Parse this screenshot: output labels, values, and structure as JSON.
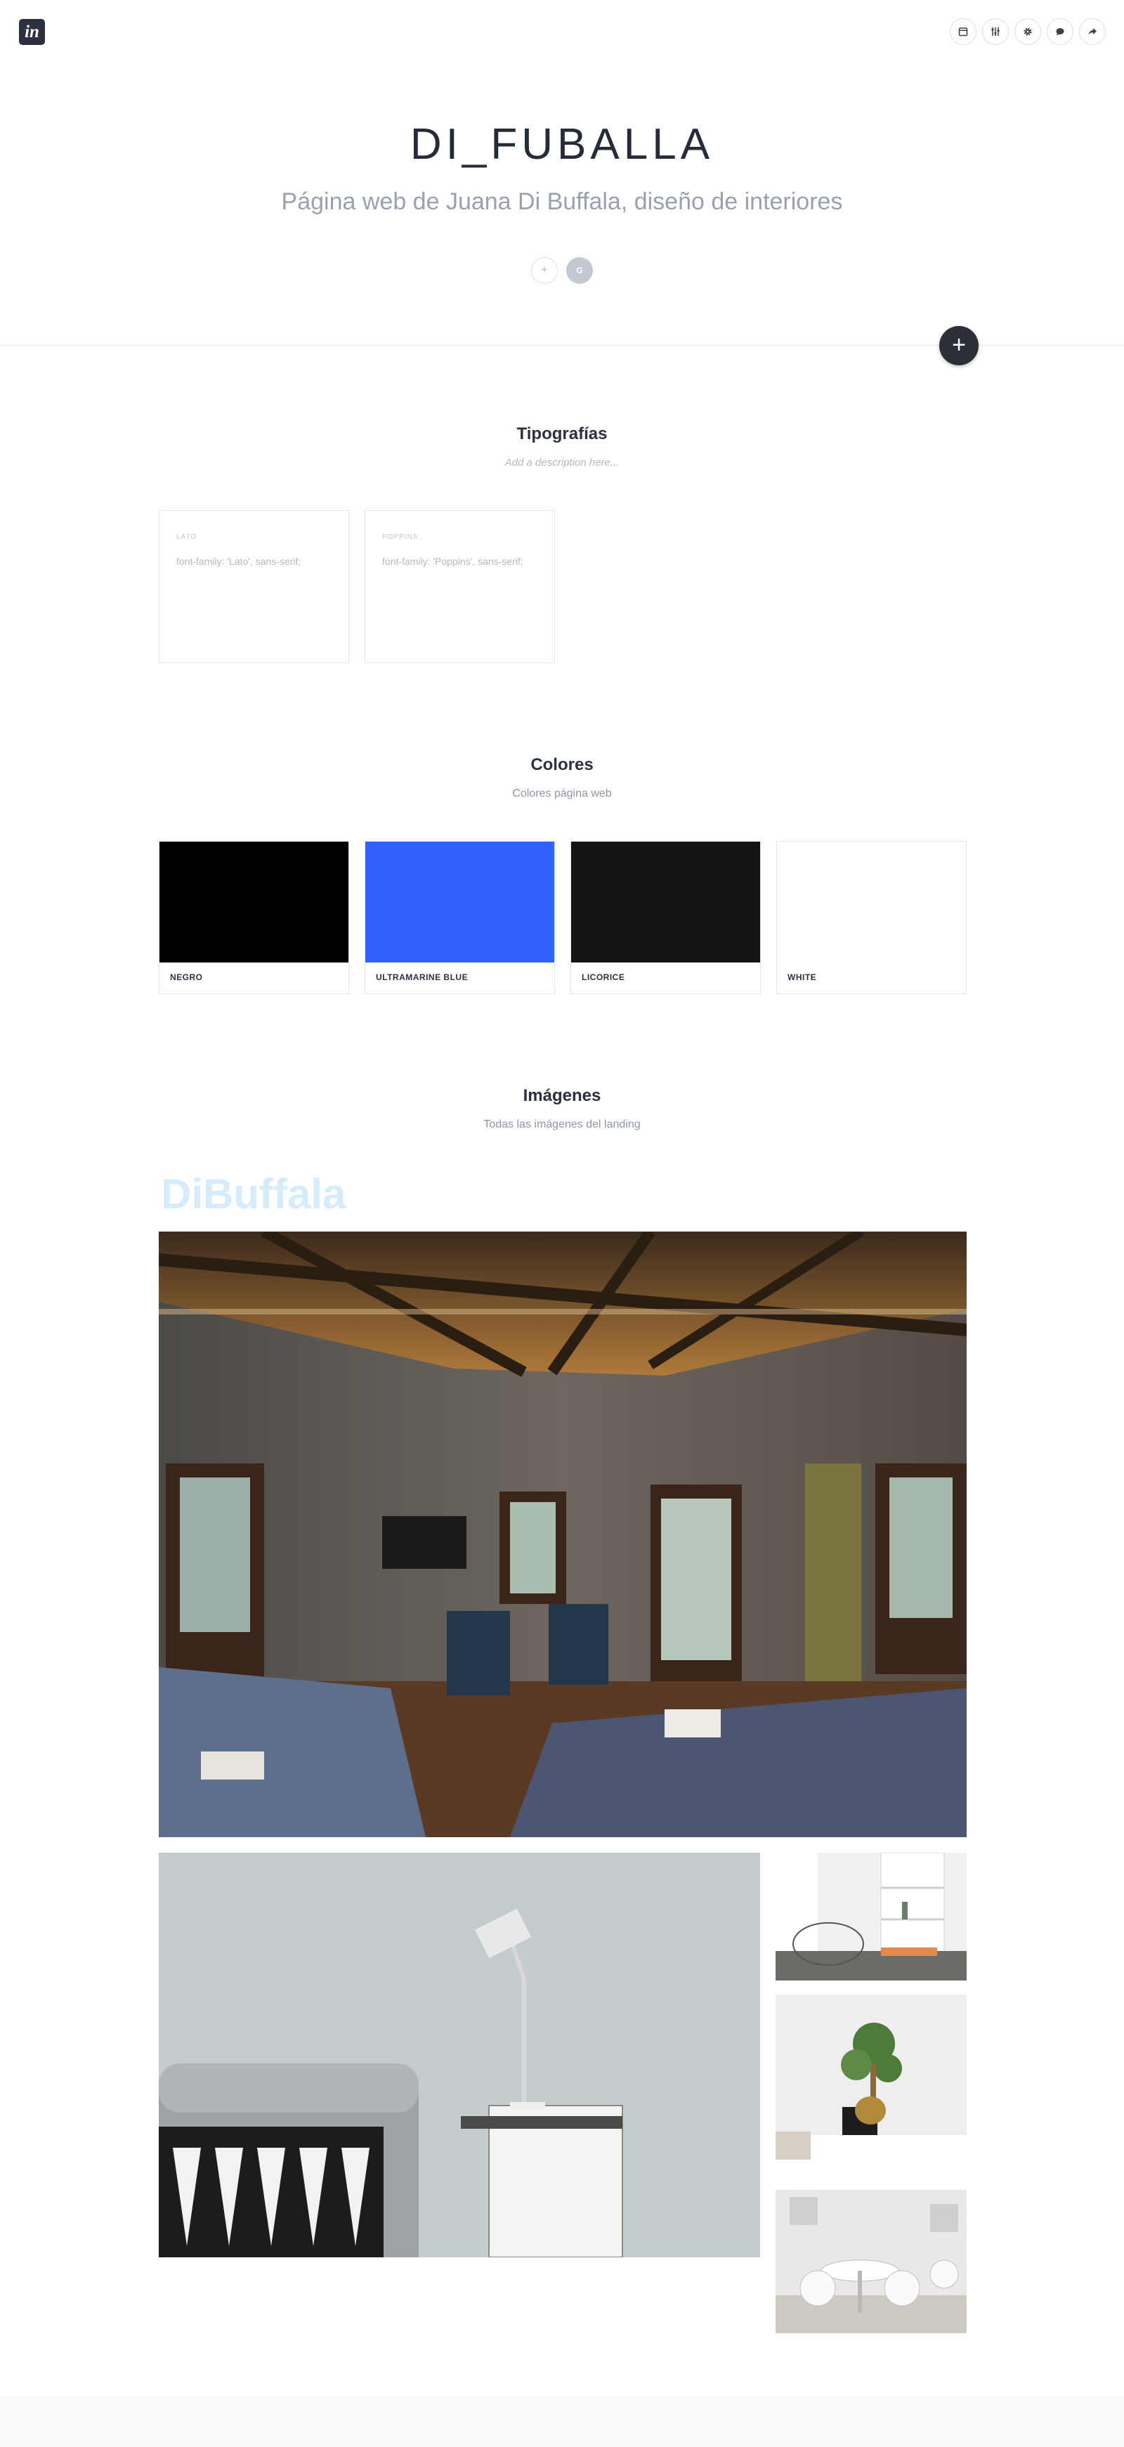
{
  "app": {
    "logo_text": "in"
  },
  "toolbar": {
    "icons": [
      "calendar-icon",
      "sliders-icon",
      "gear-icon",
      "comment-icon",
      "share-icon"
    ]
  },
  "header": {
    "title": "DI_FUBALLA",
    "subtitle": "Página web de Juana Di Buffala, diseño de interiores",
    "add_collaborator": "+",
    "avatar_initial": "G"
  },
  "fab": {
    "label": "+"
  },
  "sections": {
    "typography": {
      "title": "Tipografías",
      "description_placeholder": "Add a description here...",
      "fonts": [
        {
          "name": "LATO",
          "family": "font-family: 'Lato', sans-serif;"
        },
        {
          "name": "POPPINS",
          "family": "font-family: 'Poppins', sans-serif;"
        }
      ]
    },
    "colors": {
      "title": "Colores",
      "description": "Colores página web",
      "items": [
        {
          "name": "NEGRO",
          "hex": "#000000"
        },
        {
          "name": "ULTRAMARINE BLUE",
          "hex": "#3061fd"
        },
        {
          "name": "LICORICE",
          "hex": "#141414"
        },
        {
          "name": "WHITE",
          "hex": "#ffffff"
        }
      ]
    },
    "images": {
      "title": "Imágenes",
      "description": "Todas las imágenes del landing",
      "brand_logo_text": "DiBuffala",
      "items": [
        "bedroom-photo",
        "lamp-sofa-photo",
        "white-shelf-chair-photo",
        "bonsai-desk-photo",
        "dining-room-photo"
      ]
    }
  },
  "colors": {
    "accent_dark": "#2a2f38",
    "brand_light": "#d6ecfb"
  }
}
